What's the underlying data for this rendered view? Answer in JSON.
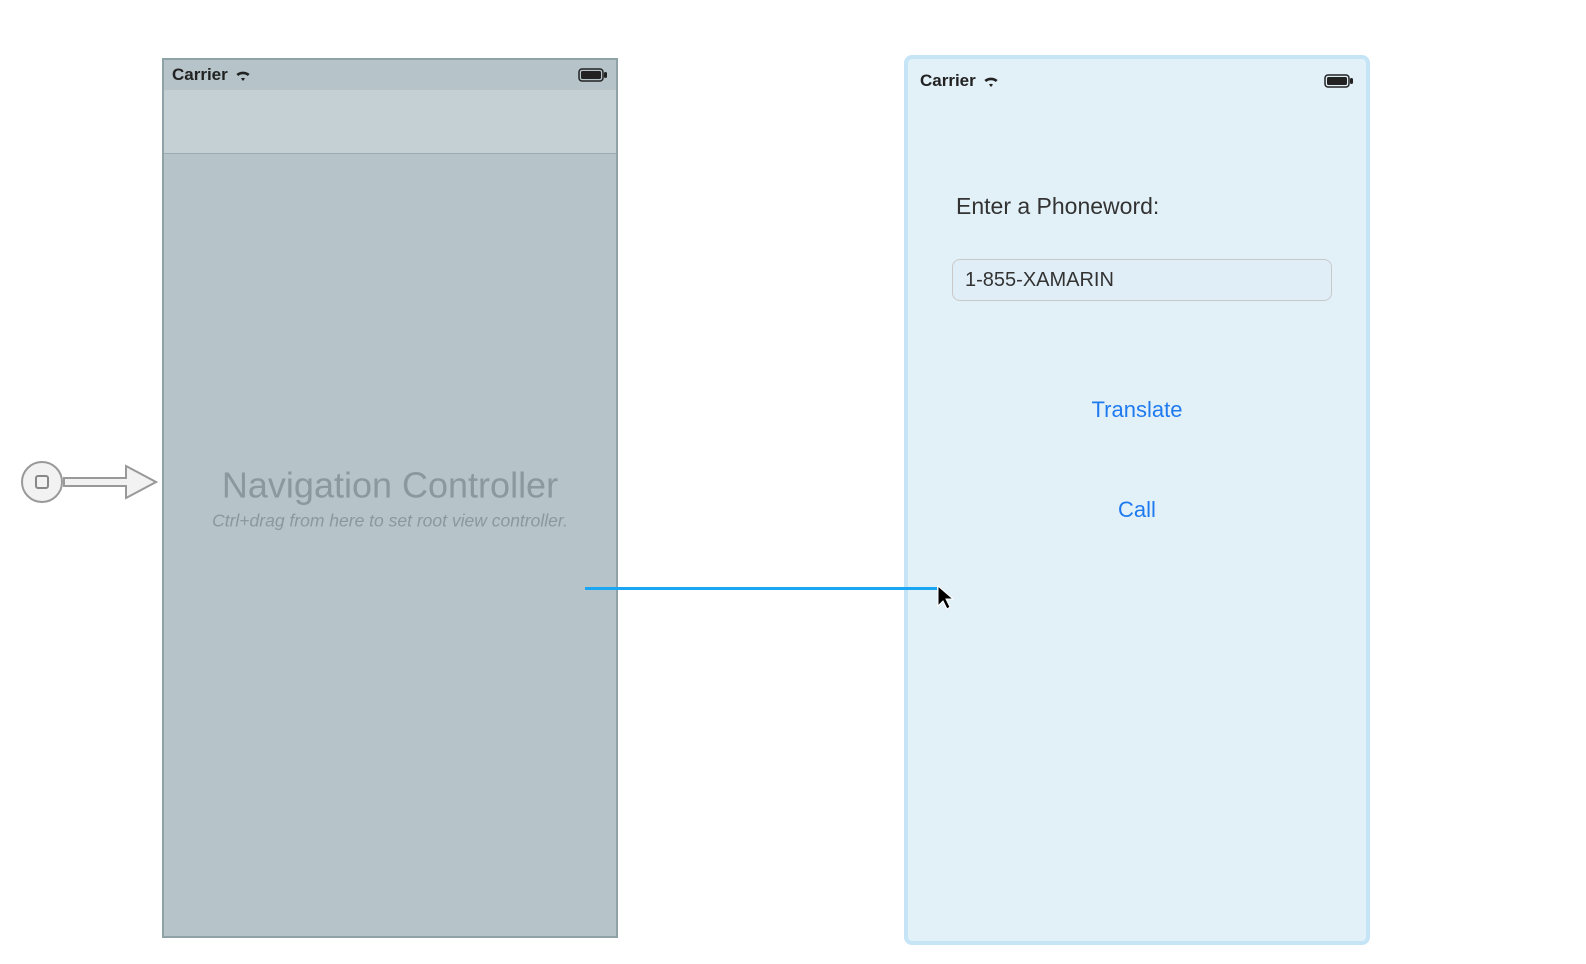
{
  "status_bar": {
    "carrier": "Carrier",
    "battery_level_pct": 100
  },
  "nav_scene": {
    "title": "Navigation Controller",
    "hint": "Ctrl+drag from here to set root view controller."
  },
  "vc_scene": {
    "label": "Enter a Phoneword:",
    "input_value": "1-855-XAMARIN",
    "translate_label": "Translate",
    "call_label": "Call",
    "selected": true
  },
  "drag": {
    "connecting": true,
    "color": "#1aa6f2"
  },
  "icons": {
    "wifi": "wifi-icon",
    "battery": "battery-full-icon",
    "cursor": "pointer-cursor-icon"
  }
}
